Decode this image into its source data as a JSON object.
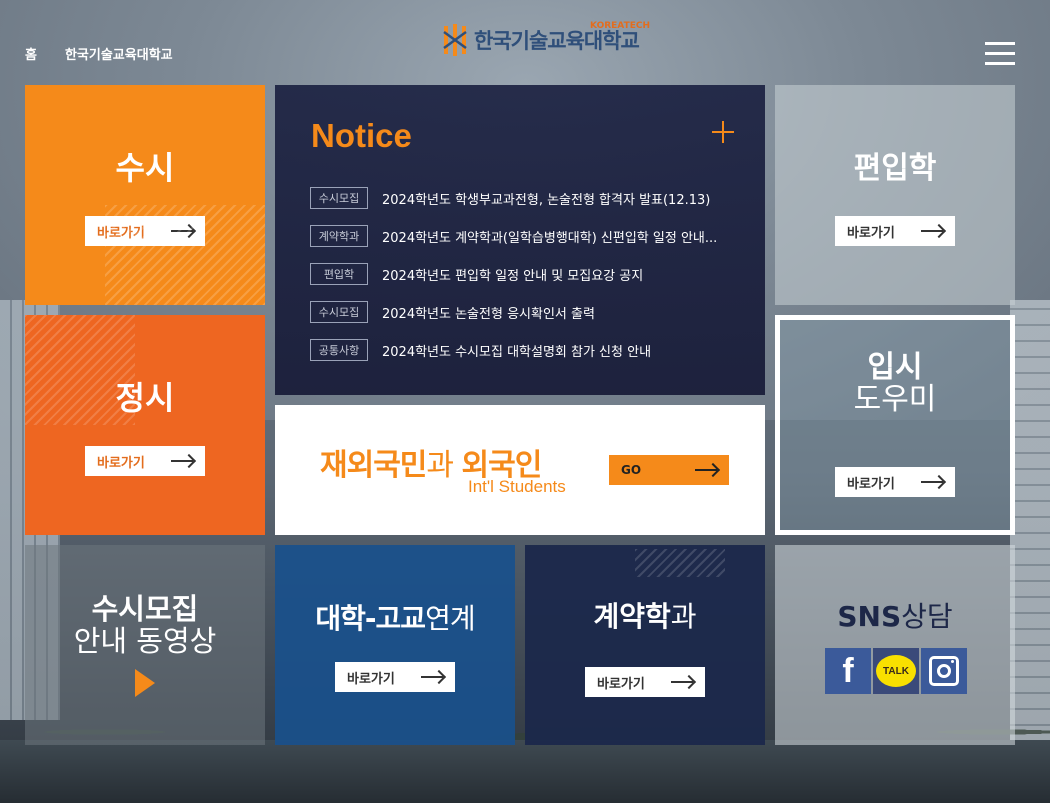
{
  "header": {
    "breadcrumb": [
      "홈",
      "한국기술교육대학교"
    ],
    "logo_text": "한국기술교육대학교",
    "logo_sub": "KOREATECH"
  },
  "tiles": {
    "susi": {
      "title": "수시",
      "button": "바로가기"
    },
    "jungsi": {
      "title": "정시",
      "button": "바로가기"
    },
    "notice": {
      "title": "Notice",
      "items": [
        {
          "tag": "수시모집",
          "text": "2024학년도 학생부교과전형, 논술전형 합격자 발표(12.13)"
        },
        {
          "tag": "계약학과",
          "text": "2024학년도 계약학과(일학습병행대학) 신편입학 일정 안내..."
        },
        {
          "tag": "편입학",
          "text": "2024학년도 편입학 일정 안내 및 모집요강 공지"
        },
        {
          "tag": "수시모집",
          "text": "2024학년도 논술전형 응시확인서 출력"
        },
        {
          "tag": "공통사항",
          "text": "2024학년도 수시모집 대학설명회 참가 신청 안내"
        }
      ]
    },
    "intl": {
      "title_bold_1": "재외국민",
      "title_light": "과 ",
      "title_bold_2": "외국인",
      "subtitle": "Int'l Students",
      "button": "GO"
    },
    "transfer": {
      "title": "편입학",
      "button": "바로가기"
    },
    "helper": {
      "title_bold": "입시",
      "title_light": "도우미",
      "button": "바로가기"
    },
    "video": {
      "title_bold": "수시모집",
      "title_light": "안내 동영상"
    },
    "univ": {
      "title_bold": "대학-고교",
      "title_light": "연계",
      "button": "바로가기"
    },
    "contract": {
      "title_bold": "계약학",
      "title_light": "과",
      "button": "바로가기"
    },
    "sns": {
      "title_bold": "SNS",
      "title_light": "상담",
      "icons": [
        "facebook-icon",
        "kakaotalk-icon",
        "instagram-icon"
      ],
      "facebook_letter": "f",
      "kakao_label": "TALK"
    }
  },
  "colors": {
    "orange": "#f58a1a",
    "orange_dark": "#ee6621",
    "navy": "#1b284b",
    "blue": "#19508c"
  }
}
